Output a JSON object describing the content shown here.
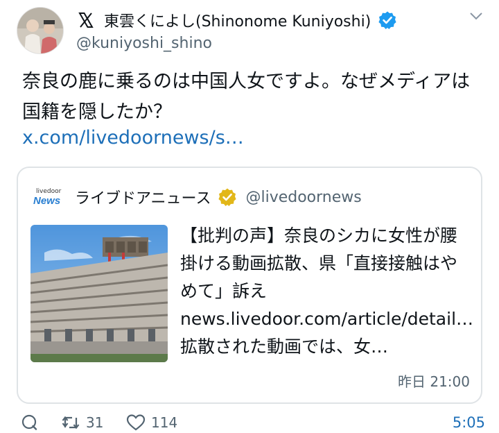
{
  "author": {
    "display_name": "東雲くによし(Shinonome Kuniyoshi)",
    "handle": "@kuniyoshi_shino",
    "brand_color": "#1d9bf0"
  },
  "tweet": {
    "text": "奈良の鹿に乗るのは中国人女ですよ。なぜメディアは国籍を隠したか？",
    "link": "x.com/livedoornews/s…"
  },
  "quoted": {
    "logo_top": "livedoor",
    "logo_bottom": "News",
    "name": "ライブドアニュース",
    "handle": "@livedoornews",
    "title": "【批判の声】奈良のシカに女性が腰掛ける動画拡散、県「直接接触はやめて」訴え news.livedoor.com/article/detail… 拡散された動画では、女…",
    "time": "昨日 21:00",
    "badge_color": "#e2b719"
  },
  "actions": {
    "reply_count": "",
    "retweet_count": "31",
    "like_count": "114",
    "time": "5:05"
  }
}
